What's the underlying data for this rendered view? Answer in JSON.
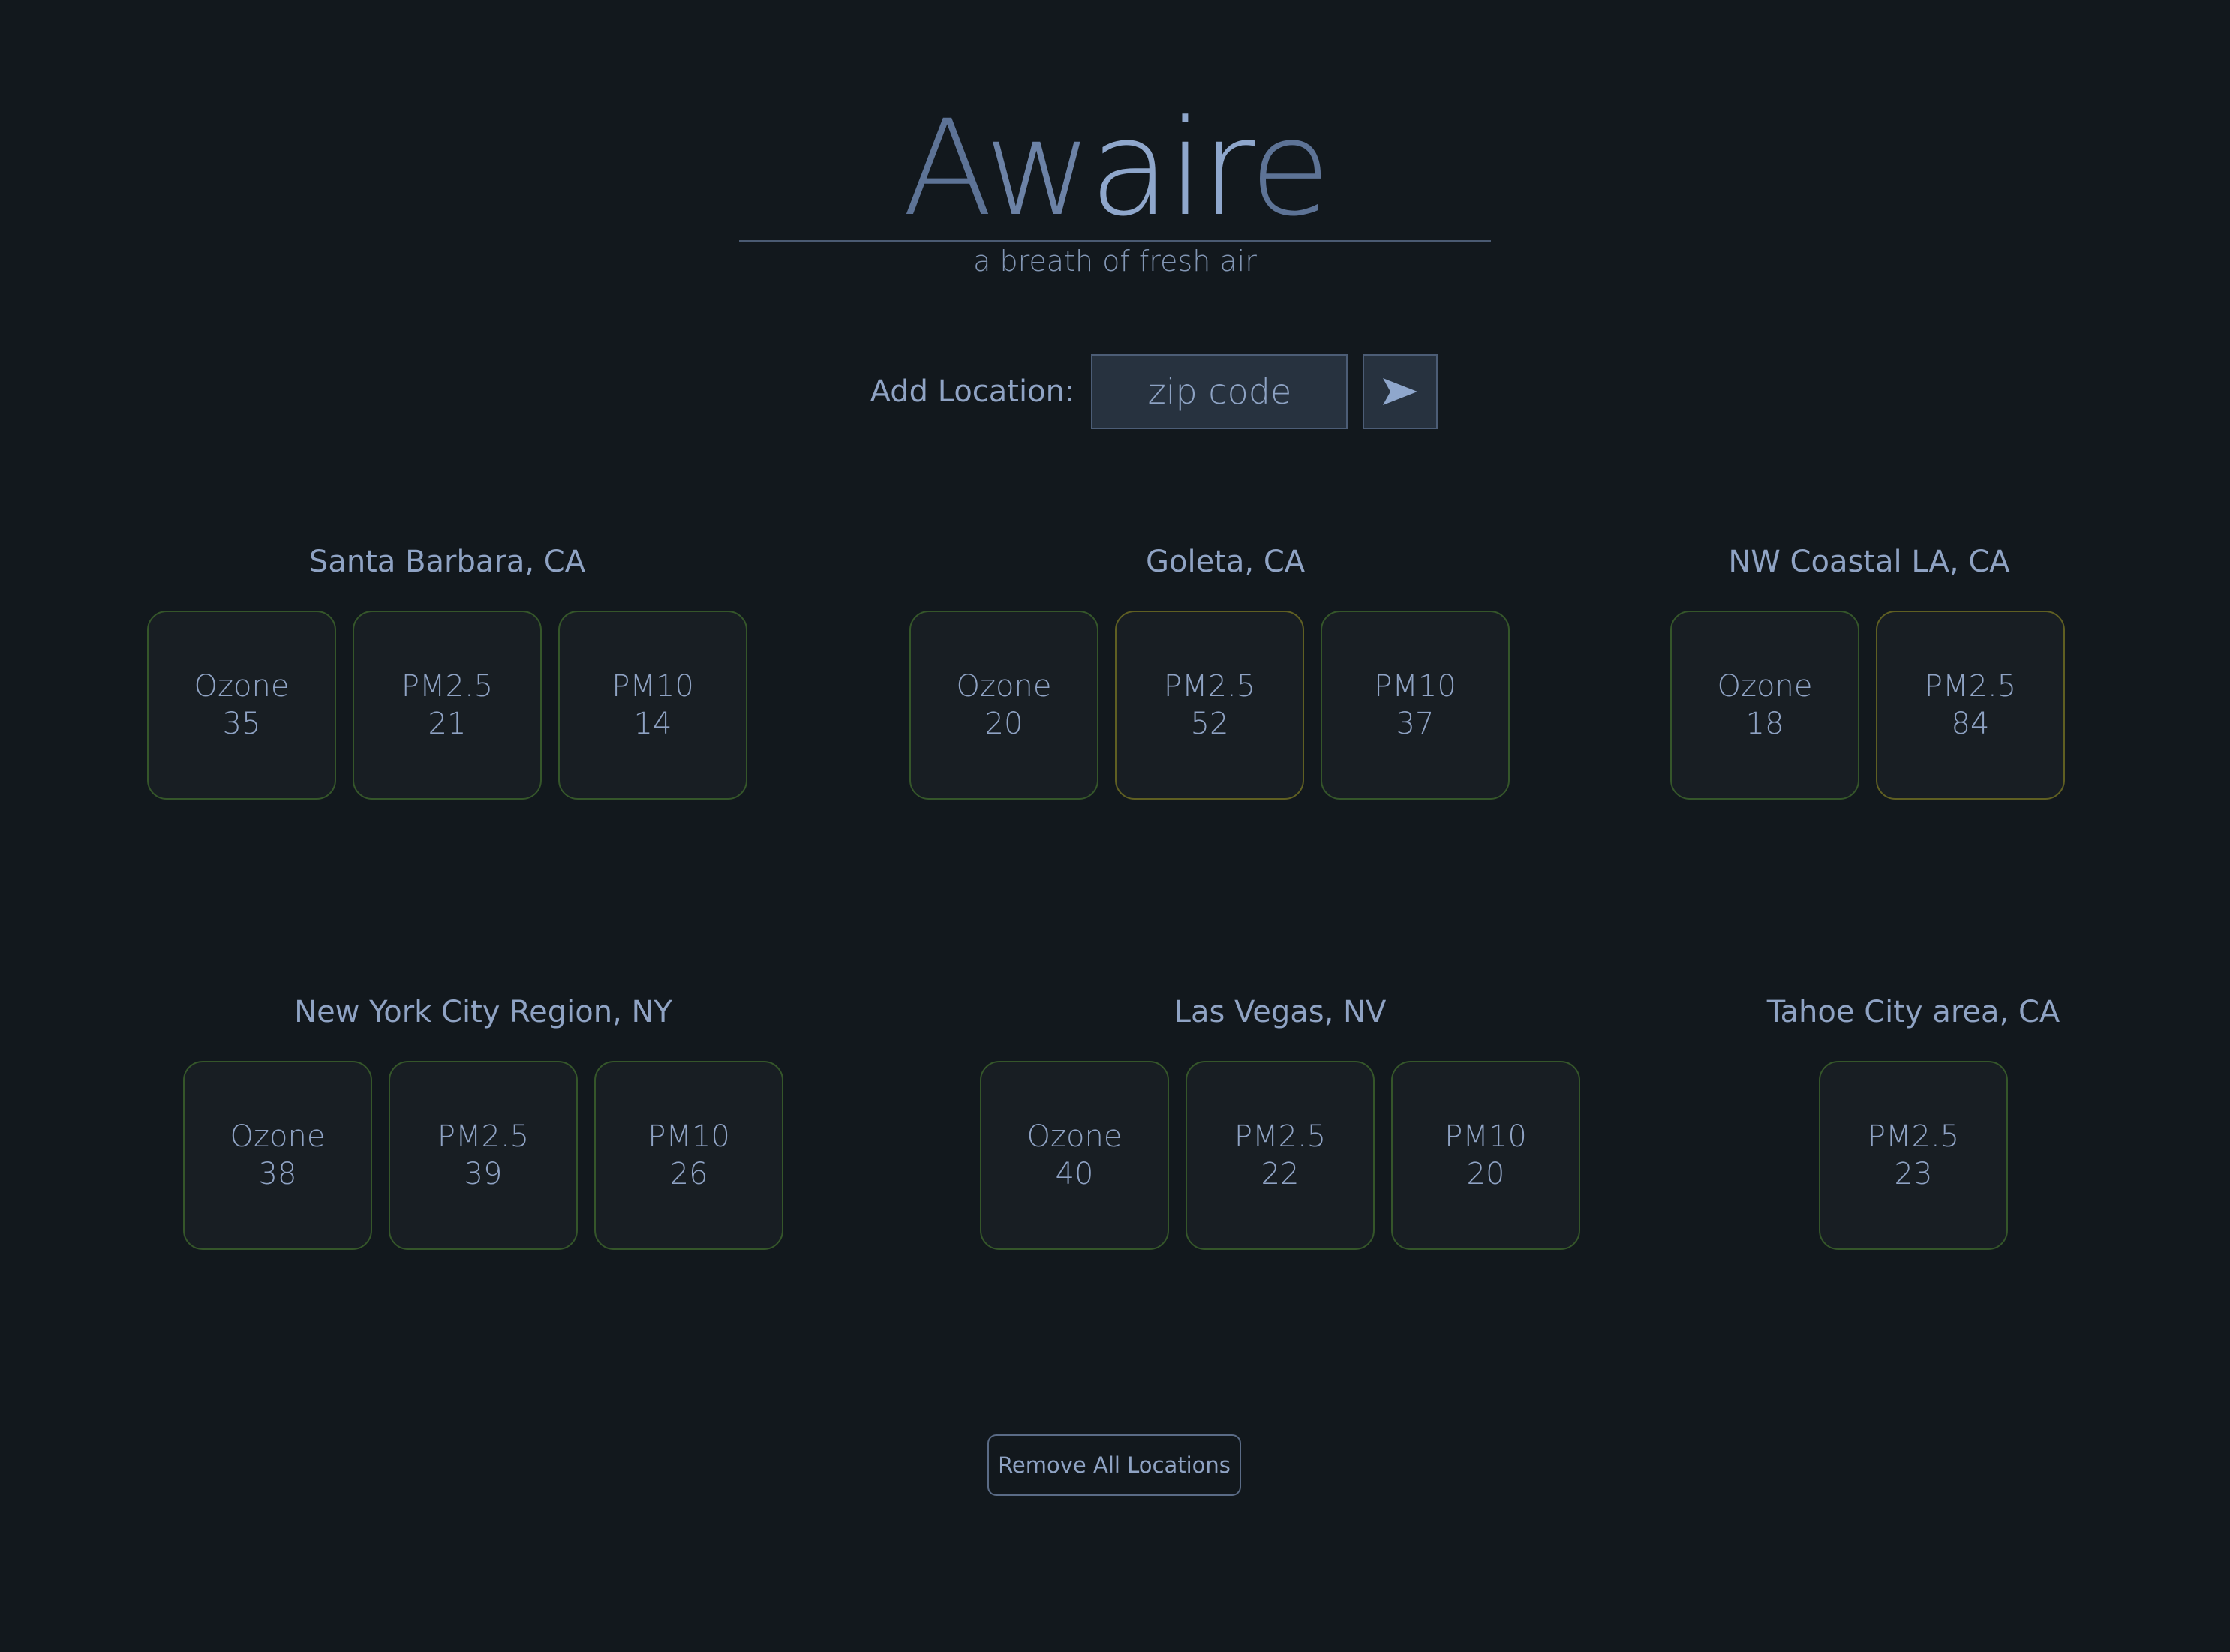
{
  "header": {
    "logo_a": "A",
    "logo_w": "w",
    "logo_air": "air",
    "logo_e": "e",
    "tagline": "a breath of fresh air"
  },
  "add_location": {
    "label": "Add Location:",
    "placeholder": "zip code",
    "submit_icon": "send-arrow-icon"
  },
  "locations": [
    {
      "name": "Santa Barbara, CA",
      "readings": [
        {
          "label": "Ozone",
          "value": "35",
          "level": "good"
        },
        {
          "label": "PM2.5",
          "value": "21",
          "level": "good"
        },
        {
          "label": "PM10",
          "value": "14",
          "level": "good"
        }
      ]
    },
    {
      "name": "Goleta, CA",
      "readings": [
        {
          "label": "Ozone",
          "value": "20",
          "level": "good"
        },
        {
          "label": "PM2.5",
          "value": "52",
          "level": "moderate"
        },
        {
          "label": "PM10",
          "value": "37",
          "level": "good"
        }
      ]
    },
    {
      "name": "NW Coastal LA, CA",
      "readings": [
        {
          "label": "Ozone",
          "value": "18",
          "level": "good"
        },
        {
          "label": "PM2.5",
          "value": "84",
          "level": "moderate"
        }
      ]
    },
    {
      "name": "New York City Region, NY",
      "readings": [
        {
          "label": "Ozone",
          "value": "38",
          "level": "good"
        },
        {
          "label": "PM2.5",
          "value": "39",
          "level": "good"
        },
        {
          "label": "PM10",
          "value": "26",
          "level": "good"
        }
      ]
    },
    {
      "name": "Las Vegas, NV",
      "readings": [
        {
          "label": "Ozone",
          "value": "40",
          "level": "good"
        },
        {
          "label": "PM2.5",
          "value": "22",
          "level": "good"
        },
        {
          "label": "PM10",
          "value": "20",
          "level": "good"
        }
      ]
    },
    {
      "name": "Tahoe City area, CA",
      "readings": [
        {
          "label": "PM2.5",
          "value": "23",
          "level": "good"
        }
      ]
    }
  ],
  "remove_all_label": "Remove All Locations",
  "colors": {
    "background": "#12181d",
    "text": "#8fa3c4",
    "good_border": "#35562a",
    "moderate_border": "#5f5f22"
  }
}
